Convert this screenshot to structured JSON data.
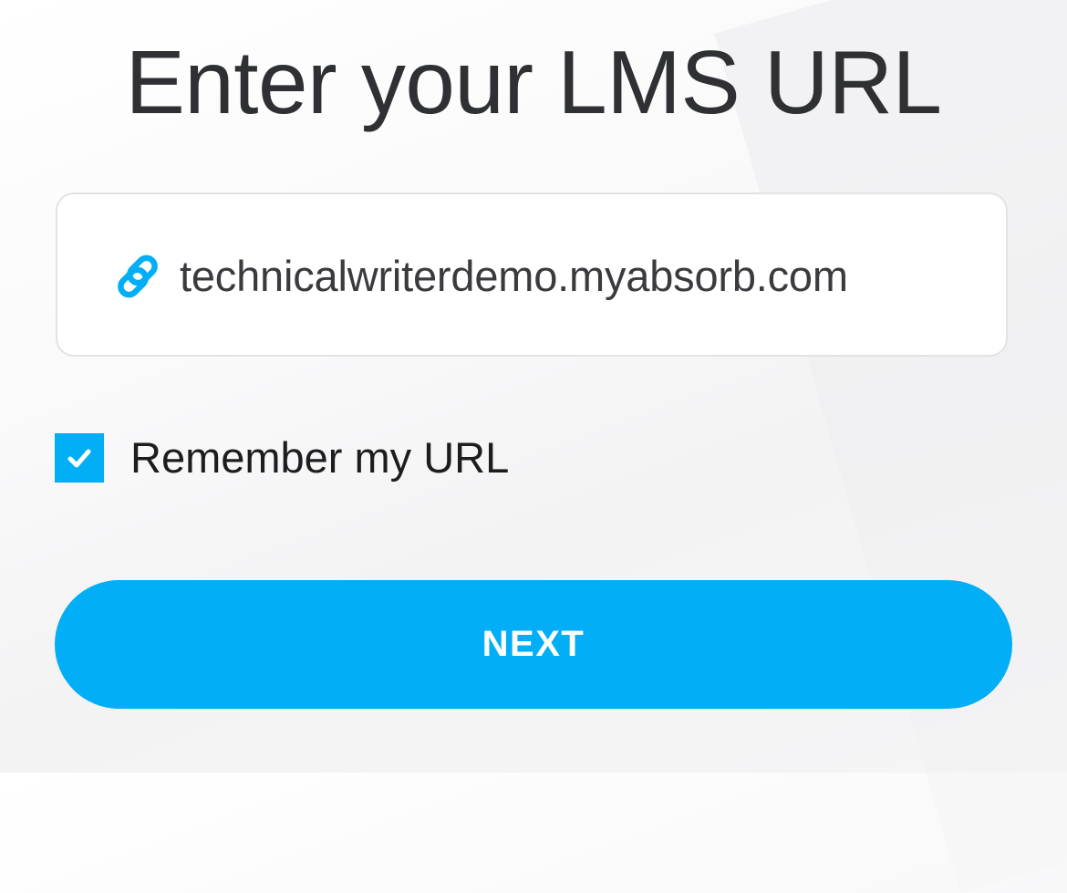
{
  "page": {
    "title": "Enter your LMS URL"
  },
  "url_field": {
    "icon": "link-icon",
    "value": "technicalwriterdemo.myabsorb.com"
  },
  "remember": {
    "checked": true,
    "label": "Remember my URL",
    "icon": "checkmark-icon"
  },
  "next_button": {
    "label": "NEXT"
  },
  "colors": {
    "accent": "#02aef5",
    "title_text": "#2f3034",
    "body_text": "#1d1d20",
    "field_border": "#e3e3e5"
  }
}
